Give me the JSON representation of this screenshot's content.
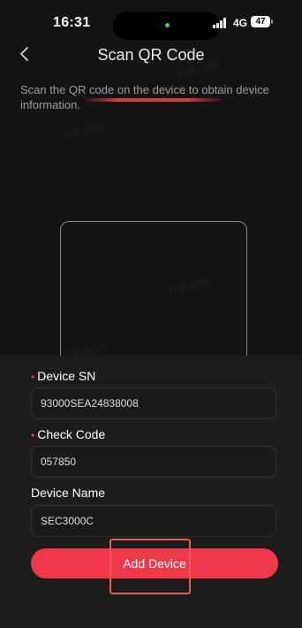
{
  "status_bar": {
    "time": "16:31",
    "network": "4G",
    "battery": "47"
  },
  "nav": {
    "title": "Scan QR Code",
    "back_icon": "chevron-left-icon"
  },
  "instruction": "Scan the QR code on the device to obtain device information.",
  "form": {
    "device_sn": {
      "label": "Device SN",
      "required_mark": "•",
      "value": "93000SEA24838008"
    },
    "check_code": {
      "label": "Check Code",
      "required_mark": "•",
      "value": "057850"
    },
    "device_name": {
      "label": "Device Name",
      "value": "SEC3000C"
    }
  },
  "add_button_label": "Add Device",
  "watermark": "行家 1993",
  "colors": {
    "accent": "#f0384a",
    "required": "#e8404d",
    "background": "#141414"
  }
}
